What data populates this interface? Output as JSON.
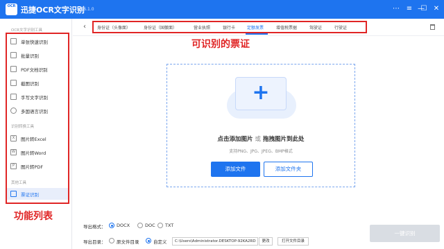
{
  "app": {
    "logo_text": "OCR",
    "title": "迅捷OCR文字识别",
    "version": "v8.6.1.0"
  },
  "window_controls": {
    "more": "⋯",
    "menu": "≡",
    "minimize": "—",
    "maximize": "☐",
    "close": "✕"
  },
  "sidebar": {
    "groups": [
      {
        "title": "OCR文字识别工具",
        "items": [
          {
            "label": "单张快速识别",
            "icon": "single-image-icon"
          },
          {
            "label": "批量识别",
            "icon": "batch-icon"
          },
          {
            "label": "PDF文档识别",
            "icon": "pdf-doc-icon"
          },
          {
            "label": "截图识别",
            "icon": "screenshot-icon"
          },
          {
            "label": "手写文字识别",
            "icon": "handwriting-icon"
          },
          {
            "label": "多国语言识别",
            "icon": "globe-icon"
          }
        ]
      },
      {
        "title": "识别转换工具",
        "items": [
          {
            "label": "图片转Excel",
            "icon": "excel-icon",
            "glyph": "X"
          },
          {
            "label": "图片转Word",
            "icon": "word-icon",
            "glyph": "W"
          },
          {
            "label": "图片转PDF",
            "icon": "pdf-icon",
            "glyph": "P"
          }
        ]
      },
      {
        "title": "其他工具",
        "items": [
          {
            "label": "票证识别",
            "icon": "ticket-icon",
            "active": true
          }
        ]
      }
    ],
    "annotation": "功能列表"
  },
  "tabs": {
    "items": [
      {
        "label": "身份证（头像面）"
      },
      {
        "label": "身份证（国徽面）"
      },
      {
        "label": "营业执照"
      },
      {
        "label": "银行卡"
      },
      {
        "label": "定额发票",
        "active": true
      },
      {
        "label": "增值税票据"
      },
      {
        "label": "驾驶证"
      },
      {
        "label": "行驶证"
      }
    ],
    "back": "‹",
    "annotation": "可识别的票证"
  },
  "dropzone": {
    "main_text_a": "点击添加图片",
    "or_text": "或",
    "main_text_b": "拖拽图片到此处",
    "formats": "支持PNG、JPG、JPEG、BMP格式",
    "add_file": "添加文件",
    "add_folder": "添加文件夹"
  },
  "output": {
    "format_label": "导出格式：",
    "formats": [
      {
        "label": "DOCX",
        "checked": true
      },
      {
        "label": "DOC",
        "checked": false
      },
      {
        "label": "TXT",
        "checked": false
      }
    ],
    "dir_label": "导出目录：",
    "dir_options": [
      {
        "label": "原文件目录",
        "checked": false
      },
      {
        "label": "自定义",
        "checked": true
      }
    ],
    "path": "C:\\Users\\Administrator.DESKTOP-92KA2RD",
    "change_button": "更改",
    "open_folder_button": "打开文件目录",
    "recognize_button": "一键识别"
  },
  "colors": {
    "primary": "#1e74ef",
    "annotation_red": "#e02525",
    "disabled_button": "#d9dde3"
  }
}
